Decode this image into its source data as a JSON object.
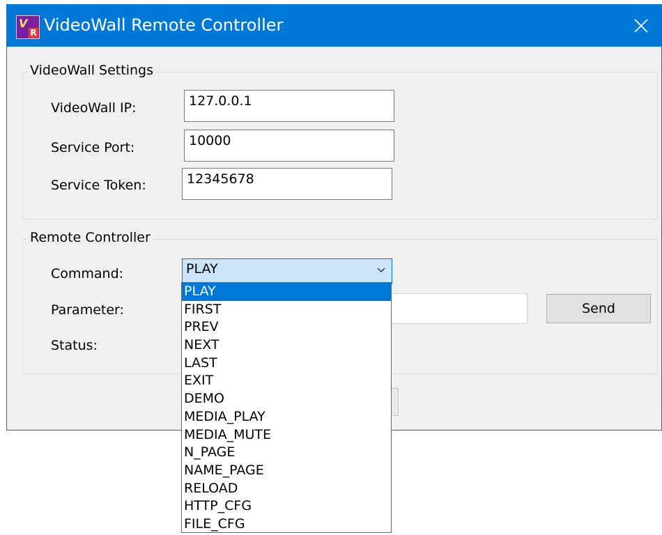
{
  "window": {
    "title": "VideoWall Remote Controller"
  },
  "settings": {
    "legend": "VideoWall Settings",
    "ip_label": "VideoWall IP:",
    "ip_value": "127.0.0.1",
    "port_label": "Service Port:",
    "port_value": "10000",
    "token_label": "Service Token:",
    "token_value": "12345678"
  },
  "remote": {
    "legend": "Remote Controller",
    "command_label": "Command:",
    "command_value": "PLAY",
    "parameter_label": "Parameter:",
    "parameter_value": "",
    "status_label": "Status:",
    "send_label": "Send"
  },
  "dropdown": {
    "options": [
      "PLAY",
      "FIRST",
      "PREV",
      "NEXT",
      "LAST",
      "EXIT",
      "DEMO",
      "MEDIA_PLAY",
      "MEDIA_MUTE",
      "N_PAGE",
      "NAME_PAGE",
      "RELOAD",
      "HTTP_CFG",
      "FILE_CFG"
    ],
    "selected": "PLAY"
  },
  "colors": {
    "accent": "#0078d7",
    "combo_bg": "#cce4f7",
    "window_bg": "#f0f0f0"
  },
  "icons": {
    "app": "videowall-app-icon",
    "close": "close-icon",
    "chevron": "chevron-down-icon"
  }
}
